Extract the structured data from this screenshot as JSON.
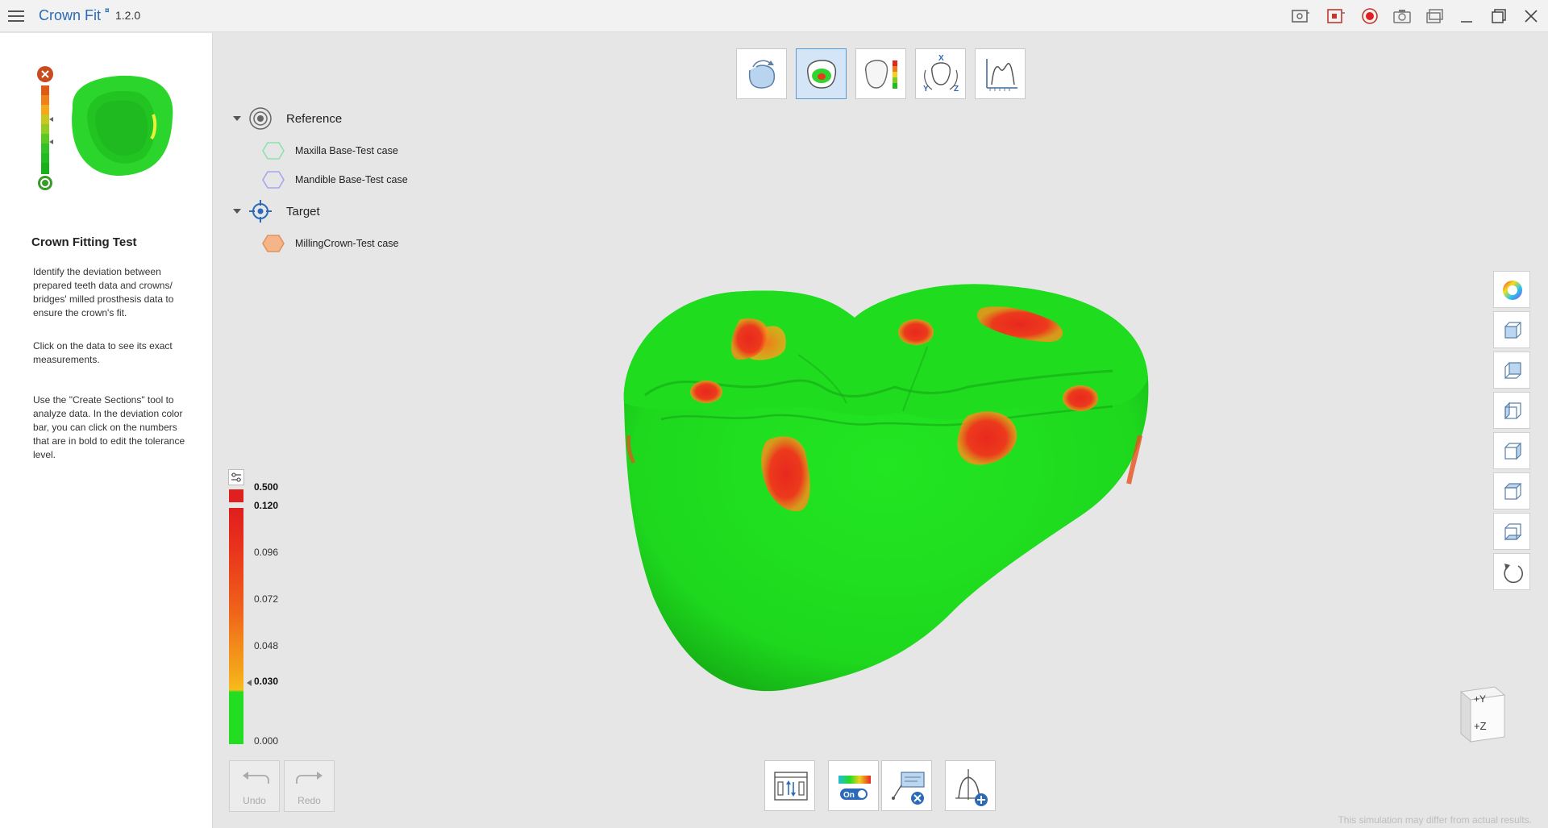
{
  "app": {
    "title": "Crown Fit",
    "badge": "¤",
    "version": "1.2.0"
  },
  "left_panel": {
    "title": "Crown Fitting Test",
    "paragraphs": [
      "Identify the deviation between prepared teeth data and crowns/ bridges' milled prosthesis data to ensure the crown's fit.",
      "Click on the data to see its exact measurements.",
      "Use the \"Create Sections\" tool to analyze data. In the deviation color bar, you can click on the numbers that are in bold to edit the tolerance level."
    ]
  },
  "tree": {
    "reference": {
      "label": "Reference",
      "items": [
        "Maxilla Base-Test case",
        "Mandible Base-Test case"
      ]
    },
    "target": {
      "label": "Target",
      "items": [
        "MillingCrown-Test case"
      ]
    }
  },
  "legend": {
    "values": [
      "0.500",
      "0.120",
      "0.096",
      "0.072",
      "0.048",
      "0.030",
      "0.000"
    ]
  },
  "bottom": {
    "undo_label": "Undo",
    "redo_label": "Redo",
    "toggle_label": "On"
  },
  "navcube": {
    "top_face": "+Y",
    "front_face": "+Z"
  },
  "tool_icons": {
    "xyz_x": "X",
    "xyz_y": "Y",
    "xyz_z": "Z"
  },
  "disclaimer": "This simulation may differ from actual results.",
  "colors": {
    "accent": "#2a6ab8",
    "fit_green": "#22dd22",
    "deviation_red": "#e8281e",
    "deviation_orange": "#f07a1a",
    "active_tool": "#d3e5f7"
  }
}
